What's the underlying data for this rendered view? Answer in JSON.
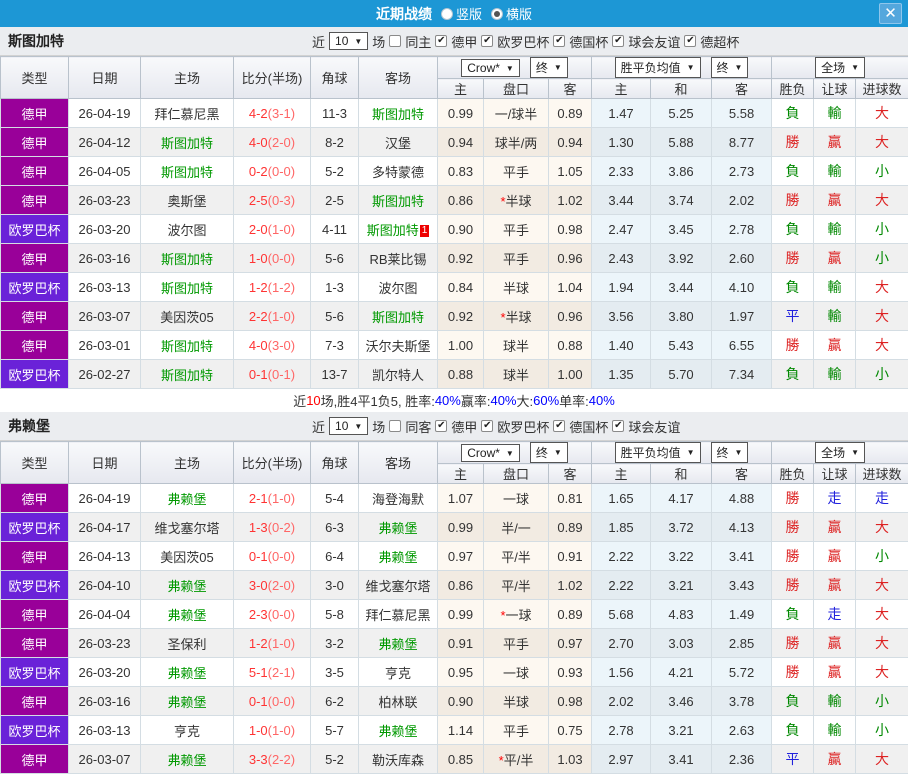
{
  "titlebar": {
    "title": "近期战绩",
    "radios": [
      {
        "label": "竖版",
        "checked": false
      },
      {
        "label": "横版",
        "checked": true
      }
    ]
  },
  "icons": {
    "close": "✕",
    "dropdown_arrow": "▼",
    "check": "✔"
  },
  "colors": {
    "topbar": "#1d97d5",
    "close_button": "#54a7dd",
    "section_header_bg": "#ebedf0"
  },
  "type_colors": {
    "德甲": "#990099",
    "欧罗巴杯": "#6a22d8"
  },
  "result_colors": {
    "勝": "#dd2222",
    "贏": "#dd2222",
    "大": "#dd2222",
    "負": "#008800",
    "輸": "#008800",
    "小": "#008800",
    "平": "#2222dd",
    "走": "#2222dd"
  },
  "table": {
    "main_headers": [
      "类型",
      "日期",
      "主场",
      "比分(半场)",
      "角球",
      "客场"
    ],
    "sub_headers": [
      "主",
      "盘口",
      "客",
      "主",
      "和",
      "客",
      "胜负",
      "让球",
      "进球数"
    ],
    "selects": {
      "crow": "Crow*",
      "end1": "终",
      "avg": "胜平负均值",
      "end2": "终",
      "full": "全场"
    }
  },
  "sections": [
    {
      "team": "斯图加特",
      "filter": {
        "prefix": "近",
        "games": "10",
        "suffix": "场",
        "same": {
          "label": "同主",
          "checked": false
        },
        "leagues": [
          {
            "label": "德甲",
            "checked": true
          },
          {
            "label": "欧罗巴杯",
            "checked": true
          },
          {
            "label": "德国杯",
            "checked": true
          },
          {
            "label": "球会友谊",
            "checked": true
          },
          {
            "label": "德超杯",
            "checked": true
          }
        ]
      },
      "rows": [
        {
          "type": "德甲",
          "date": "26-04-19",
          "home": "拜仁慕尼黑",
          "score": "4-2",
          "half": "(3-1)",
          "corner": "11-3",
          "away": "斯图加特",
          "ho": "0.99",
          "handicap": "一/球半",
          "ao": "0.89",
          "w": "1.47",
          "d": "5.25",
          "l": "5.58",
          "r1": "負",
          "r2": "輸",
          "r3": "大"
        },
        {
          "type": "德甲",
          "date": "26-04-12",
          "home": "斯图加特",
          "score": "4-0",
          "half": "(2-0)",
          "corner": "8-2",
          "away": "汉堡",
          "ho": "0.94",
          "handicap": "球半/两",
          "ao": "0.94",
          "w": "1.30",
          "d": "5.88",
          "l": "8.77",
          "r1": "勝",
          "r2": "贏",
          "r3": "大"
        },
        {
          "type": "德甲",
          "date": "26-04-05",
          "home": "斯图加特",
          "score": "0-2",
          "half": "(0-0)",
          "corner": "5-2",
          "away": "多特蒙德",
          "ho": "0.83",
          "handicap": "平手",
          "ao": "1.05",
          "w": "2.33",
          "d": "3.86",
          "l": "2.73",
          "r1": "負",
          "r2": "輸",
          "r3": "小"
        },
        {
          "type": "德甲",
          "date": "26-03-23",
          "home": "奥斯堡",
          "score": "2-5",
          "half": "(0-3)",
          "corner": "2-5",
          "away": "斯图加特",
          "ho": "0.86",
          "handicap": "*半球",
          "ao": "1.02",
          "w": "3.44",
          "d": "3.74",
          "l": "2.02",
          "r1": "勝",
          "r2": "贏",
          "r3": "大"
        },
        {
          "type": "欧罗巴杯",
          "date": "26-03-20",
          "home": "波尔图",
          "score": "2-0",
          "half": "(1-0)",
          "corner": "4-11",
          "away": "斯图加特",
          "badge": {
            "side": "away",
            "text": "1"
          },
          "ho": "0.90",
          "handicap": "平手",
          "ao": "0.98",
          "w": "2.47",
          "d": "3.45",
          "l": "2.78",
          "r1": "負",
          "r2": "輸",
          "r3": "小"
        },
        {
          "type": "德甲",
          "date": "26-03-16",
          "home": "斯图加特",
          "score": "1-0",
          "half": "(0-0)",
          "corner": "5-6",
          "away": "RB莱比锡",
          "ho": "0.92",
          "handicap": "平手",
          "ao": "0.96",
          "w": "2.43",
          "d": "3.92",
          "l": "2.60",
          "r1": "勝",
          "r2": "贏",
          "r3": "小"
        },
        {
          "type": "欧罗巴杯",
          "date": "26-03-13",
          "home": "斯图加特",
          "score": "1-2",
          "half": "(1-2)",
          "corner": "1-3",
          "away": "波尔图",
          "ho": "0.84",
          "handicap": "半球",
          "ao": "1.04",
          "w": "1.94",
          "d": "3.44",
          "l": "4.10",
          "r1": "負",
          "r2": "輸",
          "r3": "大"
        },
        {
          "type": "德甲",
          "date": "26-03-07",
          "home": "美因茨05",
          "score": "2-2",
          "half": "(1-0)",
          "corner": "5-6",
          "away": "斯图加特",
          "ho": "0.92",
          "handicap": "*半球",
          "ao": "0.96",
          "w": "3.56",
          "d": "3.80",
          "l": "1.97",
          "r1": "平",
          "r2": "輸",
          "r3": "大"
        },
        {
          "type": "德甲",
          "date": "26-03-01",
          "home": "斯图加特",
          "score": "4-0",
          "half": "(3-0)",
          "corner": "7-3",
          "away": "沃尔夫斯堡",
          "ho": "1.00",
          "handicap": "球半",
          "ao": "0.88",
          "w": "1.40",
          "d": "5.43",
          "l": "6.55",
          "r1": "勝",
          "r2": "贏",
          "r3": "大"
        },
        {
          "type": "欧罗巴杯",
          "date": "26-02-27",
          "home": "斯图加特",
          "score": "0-1",
          "half": "(0-1)",
          "corner": "13-7",
          "away": "凯尔特人",
          "ho": "0.88",
          "handicap": "球半",
          "ao": "1.00",
          "w": "1.35",
          "d": "5.70",
          "l": "7.34",
          "r1": "負",
          "r2": "輸",
          "r3": "小"
        }
      ],
      "summary": [
        {
          "t": "近",
          "c": "dark"
        },
        {
          "t": "10",
          "c": "red"
        },
        {
          "t": "场,胜4平1负5, 胜率:",
          "c": "dark"
        },
        {
          "t": "40%",
          "c": "blue"
        },
        {
          "t": " 赢率:",
          "c": "dark"
        },
        {
          "t": "40%",
          "c": "blue"
        },
        {
          "t": " 大:",
          "c": "dark"
        },
        {
          "t": "60%",
          "c": "blue"
        },
        {
          "t": " 单率:",
          "c": "dark"
        },
        {
          "t": "40%",
          "c": "blue"
        }
      ]
    },
    {
      "team": "弗赖堡",
      "filter": {
        "prefix": "近",
        "games": "10",
        "suffix": "场",
        "same": {
          "label": "同客",
          "checked": false
        },
        "leagues": [
          {
            "label": "德甲",
            "checked": true
          },
          {
            "label": "欧罗巴杯",
            "checked": true
          },
          {
            "label": "德国杯",
            "checked": true
          },
          {
            "label": "球会友谊",
            "checked": true
          }
        ]
      },
      "rows": [
        {
          "type": "德甲",
          "date": "26-04-19",
          "home": "弗赖堡",
          "score": "2-1",
          "half": "(1-0)",
          "corner": "5-4",
          "away": "海登海默",
          "ho": "1.07",
          "handicap": "一球",
          "ao": "0.81",
          "w": "1.65",
          "d": "4.17",
          "l": "4.88",
          "r1": "勝",
          "r2": "走",
          "r3": "走"
        },
        {
          "type": "欧罗巴杯",
          "date": "26-04-17",
          "home": "维戈塞尔塔",
          "score": "1-3",
          "half": "(0-2)",
          "corner": "6-3",
          "away": "弗赖堡",
          "ho": "0.99",
          "handicap": "半/一",
          "ao": "0.89",
          "w": "1.85",
          "d": "3.72",
          "l": "4.13",
          "r1": "勝",
          "r2": "贏",
          "r3": "大"
        },
        {
          "type": "德甲",
          "date": "26-04-13",
          "home": "美因茨05",
          "score": "0-1",
          "half": "(0-0)",
          "corner": "6-4",
          "away": "弗赖堡",
          "ho": "0.97",
          "handicap": "平/半",
          "ao": "0.91",
          "w": "2.22",
          "d": "3.22",
          "l": "3.41",
          "r1": "勝",
          "r2": "贏",
          "r3": "小"
        },
        {
          "type": "欧罗巴杯",
          "date": "26-04-10",
          "home": "弗赖堡",
          "score": "3-0",
          "half": "(2-0)",
          "corner": "3-0",
          "away": "维戈塞尔塔",
          "ho": "0.86",
          "handicap": "平/半",
          "ao": "1.02",
          "w": "2.22",
          "d": "3.21",
          "l": "3.43",
          "r1": "勝",
          "r2": "贏",
          "r3": "大"
        },
        {
          "type": "德甲",
          "date": "26-04-04",
          "home": "弗赖堡",
          "score": "2-3",
          "half": "(0-0)",
          "corner": "5-8",
          "away": "拜仁慕尼黑",
          "ho": "0.99",
          "handicap": "*一球",
          "ao": "0.89",
          "w": "5.68",
          "d": "4.83",
          "l": "1.49",
          "r1": "負",
          "r2": "走",
          "r3": "大"
        },
        {
          "type": "德甲",
          "date": "26-03-23",
          "home": "圣保利",
          "score": "1-2",
          "half": "(1-0)",
          "corner": "3-2",
          "away": "弗赖堡",
          "ho": "0.91",
          "handicap": "平手",
          "ao": "0.97",
          "w": "2.70",
          "d": "3.03",
          "l": "2.85",
          "r1": "勝",
          "r2": "贏",
          "r3": "大"
        },
        {
          "type": "欧罗巴杯",
          "date": "26-03-20",
          "home": "弗赖堡",
          "score": "5-1",
          "half": "(2-1)",
          "corner": "3-5",
          "away": "亨克",
          "ho": "0.95",
          "handicap": "一球",
          "ao": "0.93",
          "w": "1.56",
          "d": "4.21",
          "l": "5.72",
          "r1": "勝",
          "r2": "贏",
          "r3": "大"
        },
        {
          "type": "德甲",
          "date": "26-03-16",
          "home": "弗赖堡",
          "score": "0-1",
          "half": "(0-0)",
          "corner": "6-2",
          "away": "柏林联",
          "ho": "0.90",
          "handicap": "半球",
          "ao": "0.98",
          "w": "2.02",
          "d": "3.46",
          "l": "3.78",
          "r1": "負",
          "r2": "輸",
          "r3": "小"
        },
        {
          "type": "欧罗巴杯",
          "date": "26-03-13",
          "home": "亨克",
          "score": "1-0",
          "half": "(1-0)",
          "corner": "5-7",
          "away": "弗赖堡",
          "ho": "1.14",
          "handicap": "平手",
          "ao": "0.75",
          "w": "2.78",
          "d": "3.21",
          "l": "2.63",
          "r1": "負",
          "r2": "輸",
          "r3": "小"
        },
        {
          "type": "德甲",
          "date": "26-03-07",
          "home": "弗赖堡",
          "score": "3-3",
          "half": "(2-2)",
          "corner": "5-2",
          "away": "勒沃库森",
          "ho": "0.85",
          "handicap": "*平/半",
          "ao": "1.03",
          "w": "2.97",
          "d": "3.41",
          "l": "2.36",
          "r1": "平",
          "r2": "贏",
          "r3": "大"
        }
      ]
    }
  ]
}
